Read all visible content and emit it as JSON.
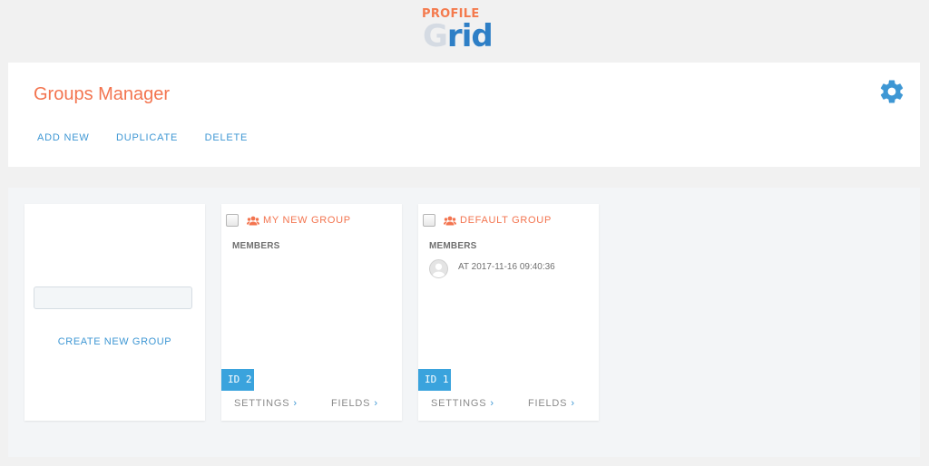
{
  "logo": {
    "top_text": "PROFILE",
    "main_g": "G",
    "main_rest": "rid"
  },
  "header": {
    "title": "Groups Manager",
    "actions": [
      "ADD NEW",
      "DUPLICATE",
      "DELETE"
    ],
    "settings_icon": "gear-icon",
    "accent_color": "#f3744f",
    "link_color": "#3e97d4"
  },
  "create_card": {
    "input_value": "",
    "create_label": "CREATE NEW GROUP"
  },
  "groups": [
    {
      "name": "MY NEW GROUP",
      "members_label": "MEMBERS",
      "members": [],
      "id_label": "ID 2",
      "settings_label": "SETTINGS",
      "fields_label": "FIELDS",
      "chevron": "›"
    },
    {
      "name": "DEFAULT GROUP",
      "members_label": "MEMBERS",
      "members": [
        {
          "text": "AT 2017-11-16 09:40:36"
        }
      ],
      "id_label": "ID 1",
      "settings_label": "SETTINGS",
      "fields_label": "FIELDS",
      "chevron": "›"
    }
  ],
  "badge_color": "#3aa3dd"
}
